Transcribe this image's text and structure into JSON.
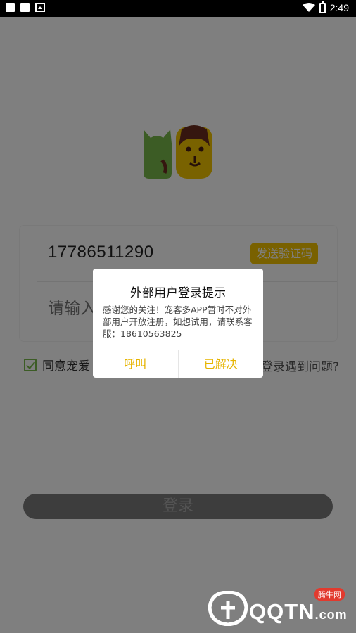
{
  "status_bar": {
    "time": "2:49"
  },
  "form": {
    "phone_value": "17786511290",
    "send_code_label": "发送验证码",
    "code_placeholder": "请输入验证码"
  },
  "agreement": {
    "label": "同意宠爱",
    "help_link": "登录遇到问题?"
  },
  "login_button": "登录",
  "dialog": {
    "title": "外部用户登录提示",
    "message": "感谢您的关注！宠客多APP暂时不对外部用户开放注册，如想试用，请联系客服：18610563825",
    "buttons": [
      "呼叫",
      "已解决"
    ]
  },
  "watermark": {
    "brand": "QQTN",
    "suffix": ".com",
    "badge": "腾牛网"
  },
  "colors": {
    "accent": "#f3c300",
    "check_green": "#79b94a",
    "dialog_button": "#e6b400"
  }
}
